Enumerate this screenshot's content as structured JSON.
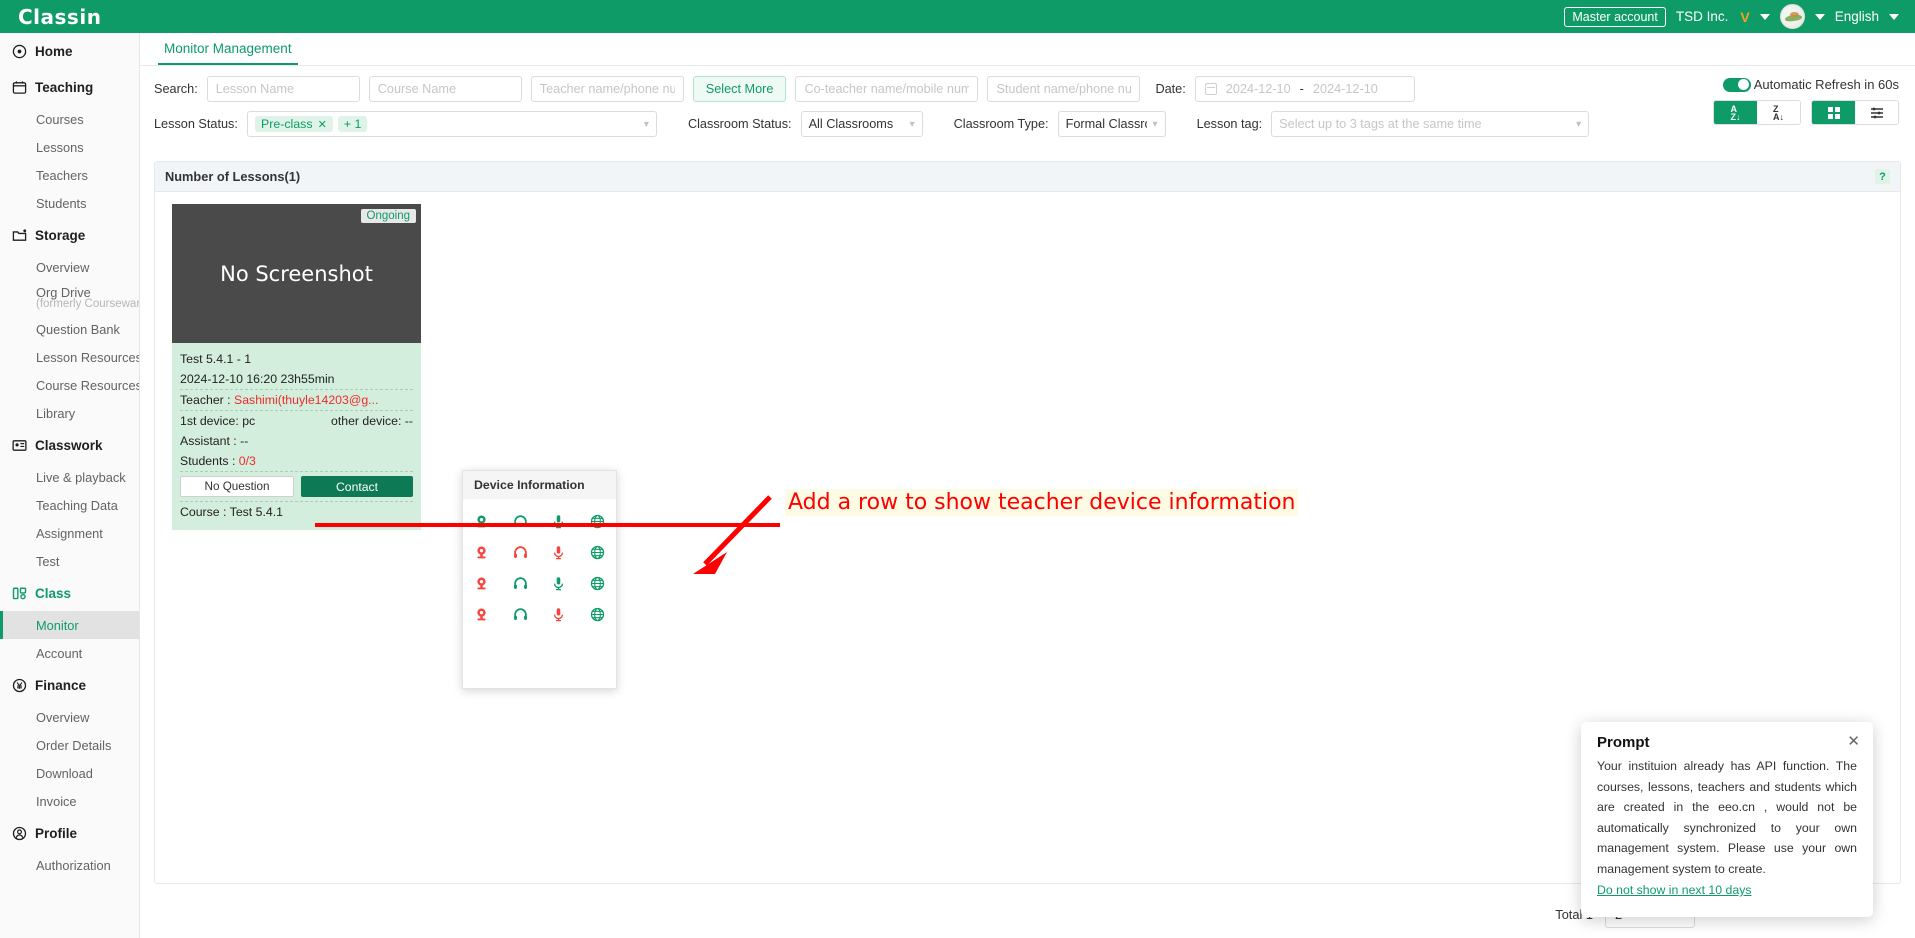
{
  "brand": {
    "logo": "Classin",
    "accent": "#0e9b68"
  },
  "topbar": {
    "master_account": "Master account",
    "org": "TSD Inc.",
    "v_badge": "V",
    "language": "English"
  },
  "sidebar": {
    "groups": [
      {
        "icon": "home-icon",
        "label": "Home",
        "items": []
      },
      {
        "icon": "teaching-icon",
        "label": "Teaching",
        "items": [
          {
            "label": "Courses"
          },
          {
            "label": "Lessons"
          },
          {
            "label": "Teachers"
          },
          {
            "label": "Students"
          }
        ]
      },
      {
        "icon": "storage-icon",
        "label": "Storage",
        "items": [
          {
            "label": "Overview"
          },
          {
            "label": "Org Drive",
            "sub": "(formerly Courseware)"
          },
          {
            "label": "Question Bank"
          },
          {
            "label": "Lesson Resources"
          },
          {
            "label": "Course Resources"
          },
          {
            "label": "Library"
          }
        ]
      },
      {
        "icon": "classwork-icon",
        "label": "Classwork",
        "items": [
          {
            "label": "Live & playback"
          },
          {
            "label": "Teaching Data"
          },
          {
            "label": "Assignment"
          },
          {
            "label": "Test"
          }
        ]
      },
      {
        "icon": "class-icon",
        "label": "Class",
        "active": true,
        "items": [
          {
            "label": "Monitor",
            "selected": true
          },
          {
            "label": "Account"
          }
        ]
      },
      {
        "icon": "finance-icon",
        "label": "Finance",
        "items": [
          {
            "label": "Overview"
          },
          {
            "label": "Order Details"
          },
          {
            "label": "Download"
          },
          {
            "label": "Invoice"
          }
        ]
      },
      {
        "icon": "profile-icon",
        "label": "Profile",
        "items": [
          {
            "label": "Authorization"
          }
        ]
      }
    ]
  },
  "tabs": [
    {
      "label": "Monitor Management",
      "active": true
    }
  ],
  "filters": {
    "search_label": "Search:",
    "lesson_name_placeholder": "Lesson Name",
    "course_name_placeholder": "Course Name",
    "teacher_placeholder": "Teacher name/phone number",
    "select_more_label": "Select More",
    "coteacher_placeholder": "Co-teacher name/mobile number",
    "student_placeholder": "Student name/phone number",
    "date_label": "Date:",
    "date_start": "2024-12-10",
    "date_sep": "-",
    "date_end": "2024-12-10",
    "lesson_status_label": "Lesson Status:",
    "lesson_status_chip": "Pre-class",
    "lesson_status_more": "+ 1",
    "classroom_status_label": "Classroom Status:",
    "classroom_status_value": "All Classrooms",
    "classroom_type_label": "Classroom Type:",
    "classroom_type_value": "Formal Classroom",
    "lesson_tag_label": "Lesson tag:",
    "lesson_tag_placeholder": "Select up to 3 tags at the same time"
  },
  "controls": {
    "auto_refresh_label": "Automatic Refresh in 60s",
    "sort_asc": "A-Z",
    "sort_desc": "Z-A",
    "view_grid": "grid-view",
    "view_list": "list-view"
  },
  "panel": {
    "title": "Number of Lessons(1)",
    "help": "?"
  },
  "lesson_card": {
    "status_badge": "Ongoing",
    "screenshot_text": "No Screenshot",
    "name": "Test 5.4.1 - 1",
    "datetime": "2024-12-10  16:20  23h55min",
    "teacher_label": "Teacher :",
    "teacher_value": "Sashimi(thuyle14203@g...",
    "first_device": "1st device: pc",
    "other_device": "other device: --",
    "assistant": "Assistant : --",
    "students_label": "Students :",
    "students_value": "0/3",
    "no_question_label": "No Question",
    "contact_label": "Contact",
    "course": "Course : Test 5.4.1"
  },
  "device_popup": {
    "title": "Device Information",
    "colors": {
      "ok": "#0e9b68",
      "bad": "#f4443c"
    },
    "rows": [
      {
        "camera": "ok",
        "headset": "ok",
        "mic": "ok",
        "network": "ok"
      },
      {
        "camera": "bad",
        "headset": "bad",
        "mic": "bad",
        "network": "ok"
      },
      {
        "camera": "bad",
        "headset": "ok",
        "mic": "ok",
        "network": "ok"
      },
      {
        "camera": "bad",
        "headset": "ok",
        "mic": "bad",
        "network": "ok"
      }
    ]
  },
  "annotation": {
    "text": "Add a row to show teacher device information",
    "color": "#ff0000"
  },
  "prompt": {
    "title": "Prompt",
    "body": "Your instituion already has API function. The courses, lessons, teachers and students which are created in the eeo.cn , would not be automatically synchronized to your own management system. Please use your own management system to create.",
    "link": "Do not show in next 10 days",
    "close": "✕"
  },
  "footer": {
    "total": "Total 1",
    "page_size": "2"
  }
}
